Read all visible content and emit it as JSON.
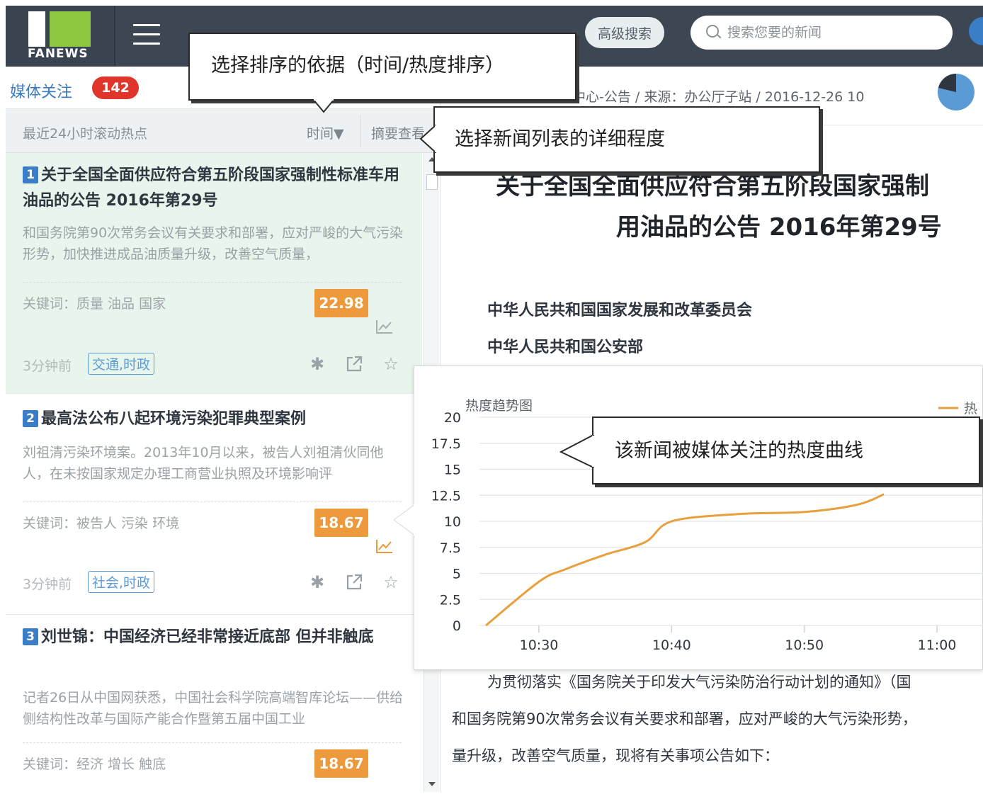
{
  "header": {
    "logo_text": "FANEWS",
    "advanced_search_label": "高级搜索",
    "search_placeholder": "搜索您要的新闻"
  },
  "left_panel": {
    "media_title": "媒体关注",
    "media_count": "142",
    "filter_label": "最近24小时滚动热点",
    "sort_label": "时间▼",
    "summary_label": "摘要查看"
  },
  "news": [
    {
      "index": "1",
      "title": "关于全国全面供应符合第五阶段国家强制性标准车用油品的公告 2016年第29号",
      "summary": "和国务院第90次常务会议有关要求和部署，应对严峻的大气污染形势，加快推进成品油质量升级，改善空气质量，",
      "keywords": "关键词：质量 油品 国家",
      "score": "22.98",
      "time": "3分钟前",
      "tag": "交通,时政"
    },
    {
      "index": "2",
      "title": "最高法公布八起环境污染犯罪典型案例",
      "summary": "刘祖清污染环境案。2013年10月以来，被告人刘祖清伙同他人，在未按国家规定办理工商营业执照及环境影响评",
      "keywords": "关键词：被告人 污染 环境",
      "score": "18.67",
      "time": "3分钟前",
      "tag": "社会,时政"
    },
    {
      "index": "3",
      "title": "刘世锦：中国经济已经非常接近底部 但并非触底",
      "summary": "记者26日从中国网获悉，中国社会科学院高端智库论坛——供给侧结构性改革与国际产能合作暨第五届中国工业",
      "keywords": "关键词：经济 增长 触底",
      "score": "18.67"
    }
  ],
  "article": {
    "breadcrumb": "中心-公告 / 来源：办公厅子站 / 2016-12-26 10",
    "title_line1": "关于全国全面供应符合第五阶段国家强制",
    "title_line2": "用油品的公告 2016年第29号",
    "issuer1": "中华人民共和国国家发展和改革委员会",
    "issuer2": "中华人民共和国公安部",
    "body_line1": "为贯彻落实《国务院关于印发大气污染防治行动计划的通知》（国",
    "body_line2": "和国务院第90次常务会议有关要求和部署，应对严峻的大气污染形势，",
    "body_line3": "量升级，改善空气质量，现将有关事项公告如下："
  },
  "callouts": {
    "sort_hint": "选择排序的依据（时间/热度排序）",
    "detail_hint": "选择新闻列表的详细程度",
    "chart_hint": "该新闻被媒体关注的热度曲线"
  },
  "colors": {
    "topbar": "#3d4754",
    "brand_green": "#8dc63f",
    "accent_blue": "#3a7ec7",
    "badge_red": "#e0352b",
    "score_orange": "#ec9a3b",
    "curve_orange": "#e8a03e"
  },
  "chart_data": {
    "type": "line",
    "title": "热度趋势图",
    "legend": "热",
    "legend_position": "top-right",
    "x_ticks": [
      "10:30",
      "10:40",
      "10:50",
      "11:00"
    ],
    "y_ticks": [
      "0",
      "2.5",
      "5",
      "7.5",
      "10",
      "12.5",
      "15",
      "17.5",
      "20"
    ],
    "ylim": [
      0,
      20
    ],
    "grid": true,
    "series": [
      {
        "name": "热",
        "points": [
          {
            "t": "10:26",
            "v": 0
          },
          {
            "t": "10:30",
            "v": 4.2
          },
          {
            "t": "10:32",
            "v": 5.4
          },
          {
            "t": "10:35",
            "v": 6.8
          },
          {
            "t": "10:38",
            "v": 8.0
          },
          {
            "t": "10:40",
            "v": 10.0
          },
          {
            "t": "10:45",
            "v": 10.7
          },
          {
            "t": "10:50",
            "v": 10.9
          },
          {
            "t": "10:54",
            "v": 11.6
          },
          {
            "t": "10:56",
            "v": 12.6
          }
        ]
      }
    ]
  }
}
